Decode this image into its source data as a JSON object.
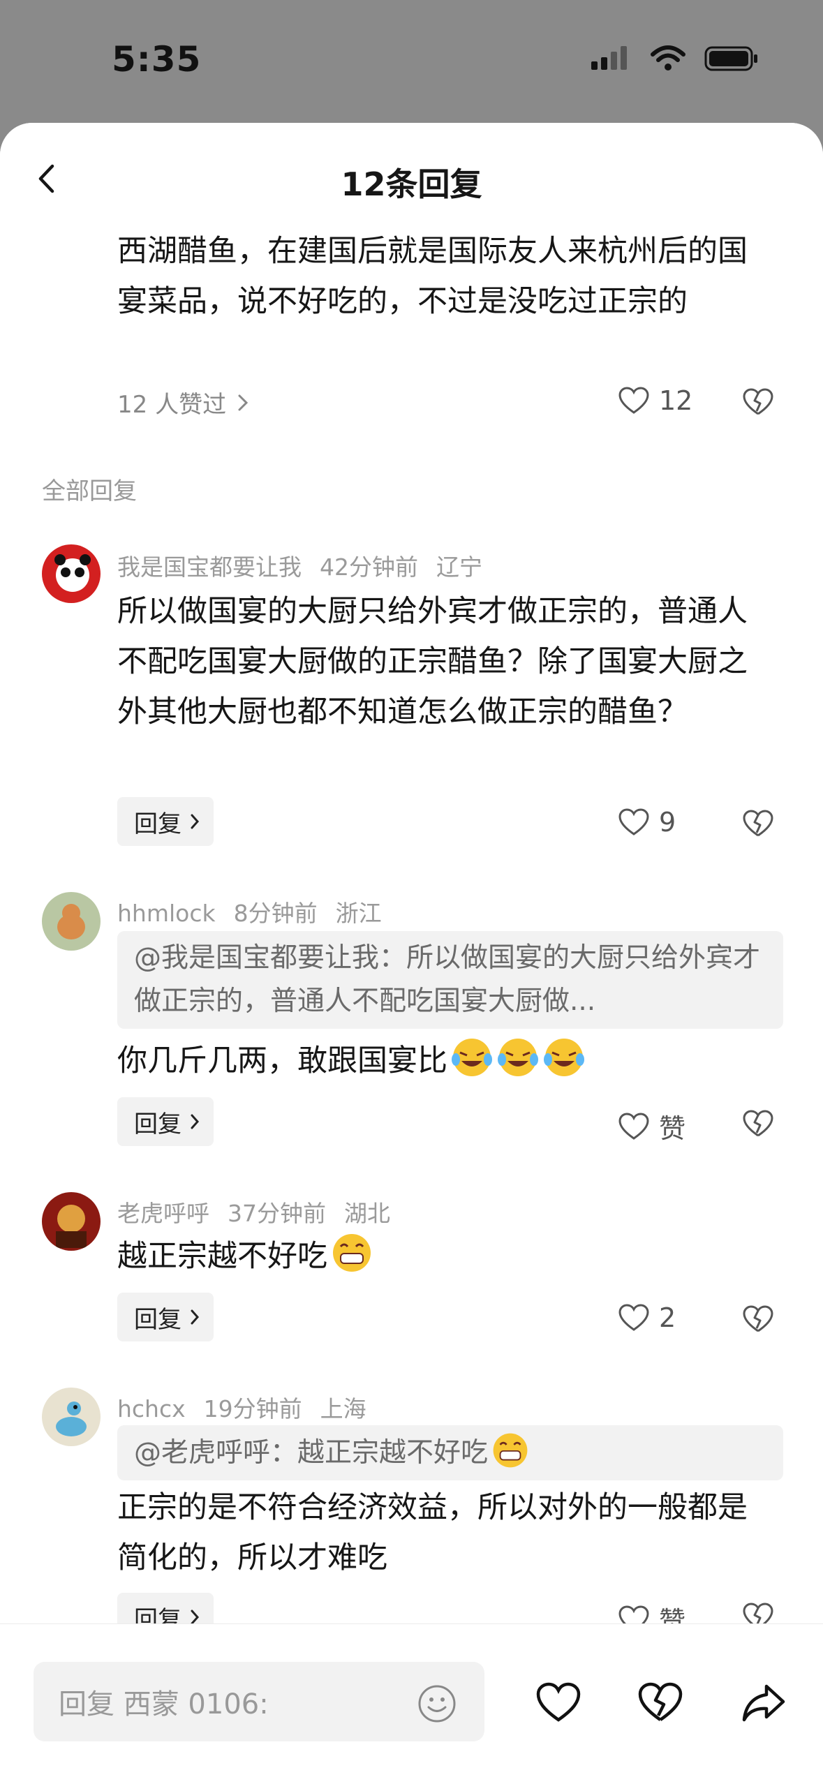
{
  "status_bar": {
    "time": "5:35"
  },
  "header": {
    "title": "12条回复"
  },
  "main_comment": {
    "text": "西湖醋鱼，在建国后就是国际友人来杭州后的国宴菜品，说不好吃的，不过是没吃过正宗的",
    "liked_by": "12 人赞过",
    "like_count": "12"
  },
  "section_label": "全部回复",
  "replies": [
    {
      "username": "我是国宝都要让我",
      "time": "42分钟前",
      "location": "辽宁",
      "text": "所以做国宴的大厨只给外宾才做正宗的，普通人不配吃国宴大厨做的正宗醋鱼？除了国宴大厨之外其他大厨也都不知道怎么做正宗的醋鱼？",
      "reply_label": "回复",
      "like_label": "9"
    },
    {
      "username": "hhmlock",
      "time": "8分钟前",
      "location": "浙江",
      "quote": "@我是国宝都要让我：所以做国宴的大厨只给外宾才做正宗的，普通人不配吃国宴大厨做...",
      "text": "你几斤几两，敢跟国宴比",
      "reply_label": "回复",
      "like_label": "赞"
    },
    {
      "username": "老虎呼呼",
      "time": "37分钟前",
      "location": "湖北",
      "text": "越正宗越不好吃",
      "reply_label": "回复",
      "like_label": "2"
    },
    {
      "username": "hchcx",
      "time": "19分钟前",
      "location": "上海",
      "quote": "@老虎呼呼：越正宗越不好吃",
      "text": "正宗的是不符合经济效益，所以对外的一般都是简化的，所以才难吃",
      "reply_label": "回复",
      "like_label": "赞"
    }
  ],
  "bottom_bar": {
    "placeholder": "回复 西蒙 0106:"
  }
}
